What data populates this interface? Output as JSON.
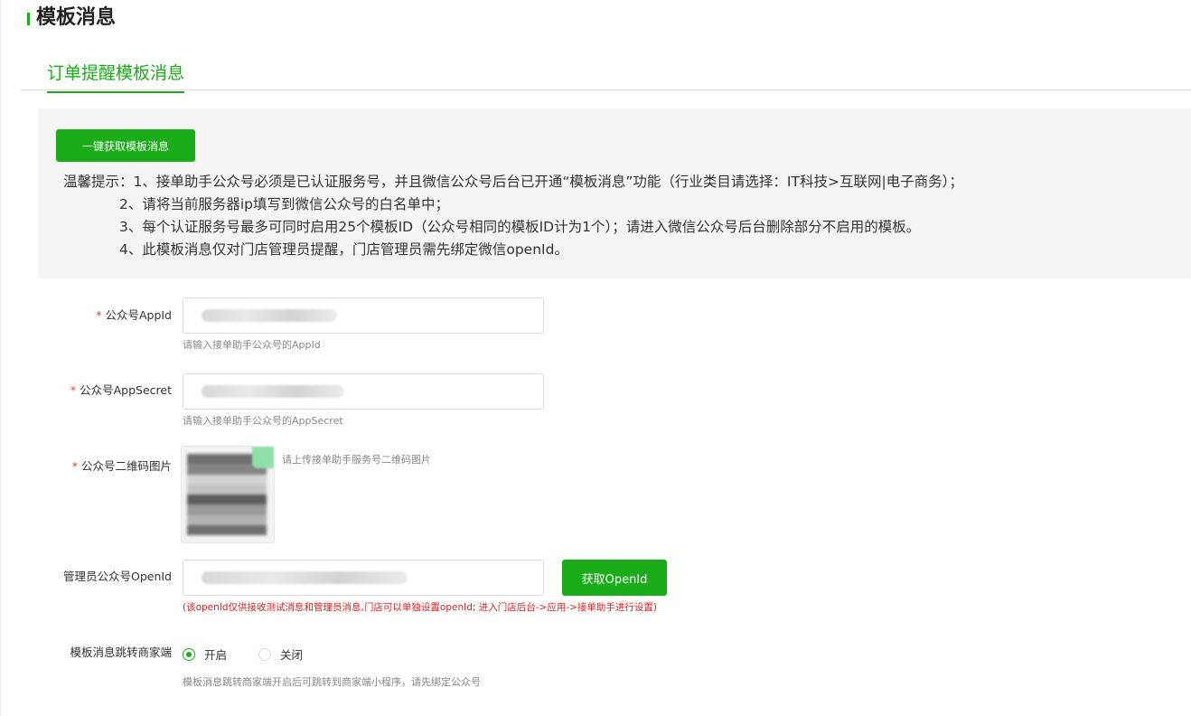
{
  "page": {
    "title": "模板消息"
  },
  "tabs": [
    {
      "label": "订单提醒模板消息"
    }
  ],
  "notice": {
    "button_label": "一键获取模板消息",
    "tips": [
      "温馨提示：1、接单助手公众号必须是已认证服务号，并且微信公众号后台已开通“模板消息”功能（行业类目请选择：IT科技>互联网|电子商务）；",
      "2、请将当前服务器ip填写到微信公众号的白名单中；",
      "3、每个认证服务号最多可同时启用25个模板ID（公众号相同的模板ID计为1个）；请进入微信公众号后台删除部分不启用的模板。",
      "4、此模板消息仅对门店管理员提醒，门店管理员需先绑定微信openId。"
    ]
  },
  "form": {
    "required_mark": "*",
    "appid": {
      "label": "公众号AppId",
      "hint": "请输入接单助手公众号的AppId"
    },
    "appsecret": {
      "label": "公众号AppSecret",
      "hint": "请输入接单助手公众号的AppSecret"
    },
    "qrcode": {
      "label": "公众号二维码图片",
      "hint": "请上传接单助手服务号二维码图片"
    },
    "openid": {
      "label": "管理员公众号OpenId",
      "button_label": "获取OpenId",
      "note": "(该openId仅供接收测试消息和管理员消息,门店可以单独设置openId; 进入门店后台->应用->接单助手进行设置)"
    },
    "jump": {
      "label": "模板消息跳转商家端",
      "options": [
        {
          "label": "开启",
          "selected": true
        },
        {
          "label": "关闭",
          "selected": false
        }
      ],
      "hint": "模板消息跳转商家端开启后可跳转到商家端小程序，请先绑定公众号"
    }
  },
  "colors": {
    "accent": "#1aad19",
    "required": "#f04134",
    "note": "#e02020"
  }
}
